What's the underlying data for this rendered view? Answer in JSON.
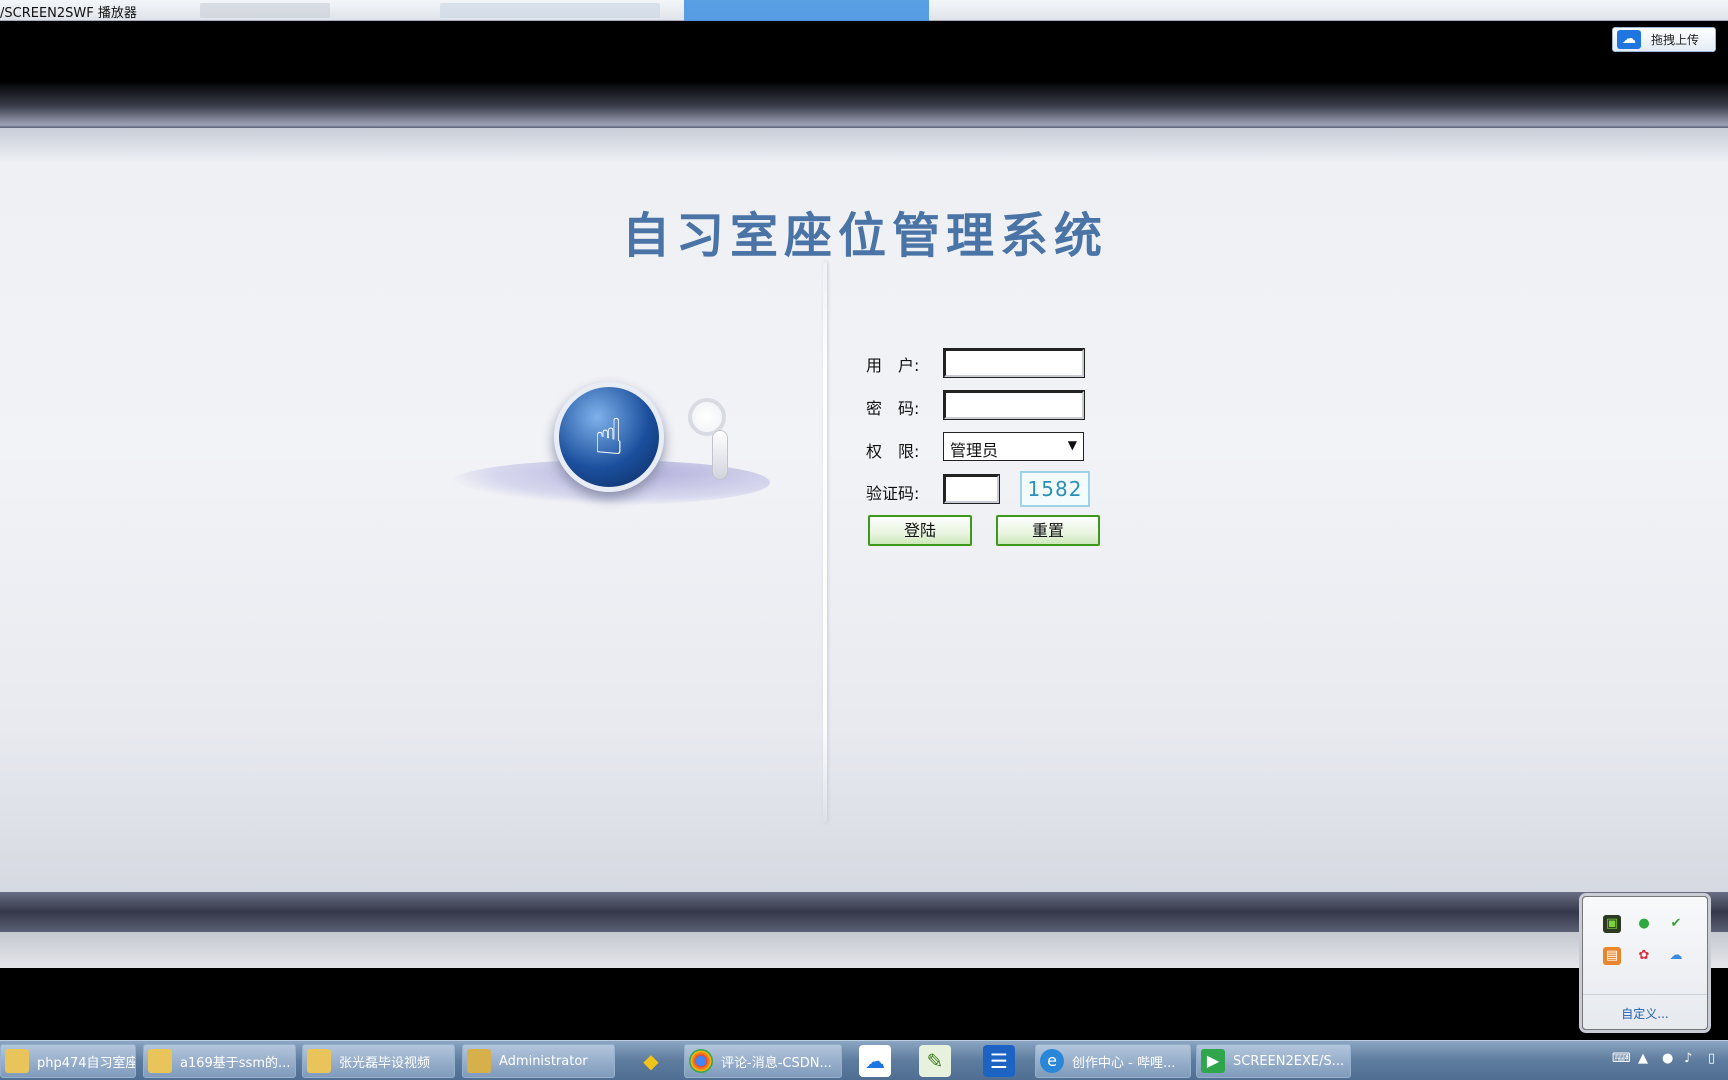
{
  "window": {
    "title": "/SCREEN2SWF 播放器"
  },
  "header": {
    "upload_label": "拖拽上传"
  },
  "page": {
    "system_title": "自习室座位管理系统"
  },
  "login_form": {
    "username_label": "用　户:",
    "username_value": "",
    "password_label": "密　码:",
    "password_value": "",
    "role_label": "权　限:",
    "role_selected": "管理员",
    "captcha_label": "验证码:",
    "captcha_value": "",
    "captcha_code": "1582",
    "login_button": "登陆",
    "reset_button": "重置"
  },
  "tray_popup": {
    "customize_label": "自定义..."
  },
  "taskbar": {
    "items": [
      {
        "label": "php474自习室座..."
      },
      {
        "label": "a169基于ssm的..."
      },
      {
        "label": "张光磊毕设视频"
      },
      {
        "label": "Administrator"
      },
      {
        "label": "评论-消息-CSDN..."
      },
      {
        "label": "创作中心 - 哔哩..."
      },
      {
        "label": "SCREEN2EXE/S..."
      }
    ]
  },
  "colors": {
    "title_blue": "#4a73a6",
    "button_green": "#3b9a1b",
    "captcha_cyan": "#2b8fb5"
  }
}
